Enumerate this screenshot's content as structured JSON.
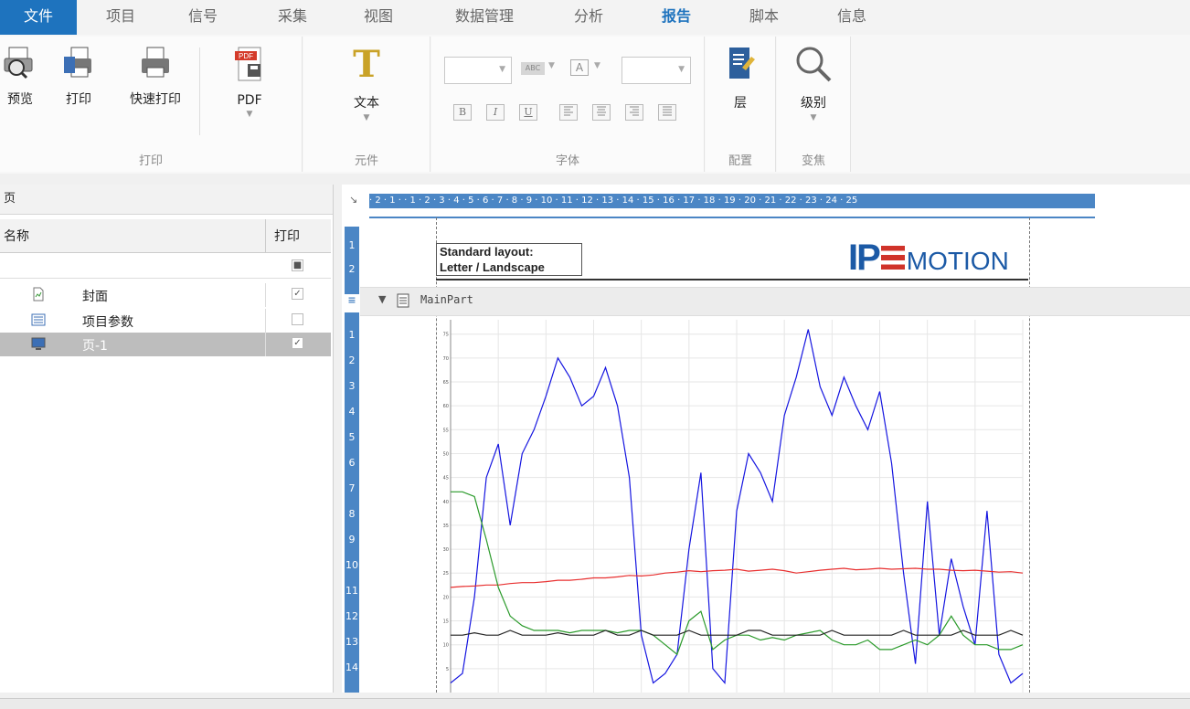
{
  "tabs": [
    "文件",
    "项目",
    "信号",
    "采集",
    "视图",
    "数据管理",
    "分析",
    "报告",
    "脚本",
    "信息"
  ],
  "ribbon": {
    "print_group": {
      "label": "打印",
      "preview": "预览",
      "print": "打印",
      "quick_print": "快速打印",
      "pdf": "PDF"
    },
    "element_group": {
      "label": "元件",
      "text": "文本"
    },
    "font_group": {
      "label": "字体",
      "abc": "ABC",
      "a": "A",
      "bold": "B",
      "italic": "I",
      "underline": "U"
    },
    "config_group": {
      "label": "配置",
      "layer": "层"
    },
    "zoom_group": {
      "label": "变焦",
      "level": "级别"
    }
  },
  "pages_panel": {
    "title": "页",
    "col_name": "名称",
    "col_print": "打印",
    "rows": [
      {
        "name": "封面",
        "checked": true
      },
      {
        "name": "项目参数",
        "checked": false
      },
      {
        "name": "页-1",
        "checked": true
      }
    ]
  },
  "editor": {
    "corner": "↘",
    "ruler_text": "· 2 · 1 ·   · 1 · 2 · 3 · 4 · 5 · 6 · 7 · 8 · 9 · 10 · 11 · 12 · 13 · 14 · 15 · 16 · 17 · 18 · 19 · 20 · 21 · 22 · 23 · 24 · 25",
    "vruler_top": [
      "1",
      "2"
    ],
    "vruler_main": [
      "1",
      "2",
      "3",
      "4",
      "5",
      "6",
      "7",
      "8",
      "9",
      "10",
      "11",
      "12",
      "13",
      "14"
    ],
    "layout_line1": "Standard layout:",
    "layout_line2": "Letter / Landscape",
    "logo_ip": "IP",
    "logo_motion": "MOTION",
    "section_title": "MainPart",
    "colors": {
      "blue": "#1515e0",
      "red": "#e83030",
      "green": "#2a9a2a",
      "black": "#222222"
    }
  },
  "chart_data": {
    "type": "line",
    "y_ticks": [
      "75",
      "70",
      "65",
      "60",
      "55",
      "50",
      "45",
      "40",
      "35",
      "30",
      "25",
      "20",
      "15",
      "10",
      "5"
    ],
    "ylim": [
      0,
      78
    ],
    "series": [
      {
        "values": [
          2,
          4,
          20,
          45,
          52,
          35,
          50,
          55,
          62,
          70,
          66,
          60,
          62,
          68,
          60,
          45,
          12,
          2,
          4,
          8,
          30,
          46,
          5,
          2,
          38,
          50,
          46,
          40,
          58,
          66,
          76,
          64,
          58,
          66,
          60,
          55,
          63,
          48,
          25,
          6,
          40,
          12,
          28,
          18,
          10,
          38,
          8,
          2,
          4
        ]
      },
      {
        "values": [
          22,
          22.2,
          22.3,
          22.5,
          22.5,
          22.8,
          23,
          23,
          23.2,
          23.5,
          23.5,
          23.7,
          24,
          24,
          24.2,
          24.5,
          24.4,
          24.6,
          25,
          25.2,
          25.5,
          25.3,
          25.5,
          25.6,
          25.8,
          25.4,
          25.6,
          25.8,
          25.5,
          25,
          25.3,
          25.6,
          25.8,
          26,
          25.7,
          25.8,
          26,
          25.8,
          25.9,
          26,
          25.8,
          25.8,
          25.6,
          25.5,
          25.6,
          25.4,
          25.2,
          25.3,
          25
        ]
      },
      {
        "values": [
          42,
          42,
          41,
          32,
          22,
          16,
          14,
          13,
          13,
          13,
          12.5,
          13,
          13,
          13,
          12.5,
          13,
          13,
          12,
          10,
          8,
          15,
          17,
          9,
          11,
          12,
          12,
          11,
          11.5,
          11,
          12,
          12.5,
          13,
          11,
          10,
          10,
          11,
          9,
          9,
          10,
          11,
          10,
          12,
          16,
          12,
          10,
          10,
          9,
          9,
          10
        ]
      },
      {
        "values": [
          12,
          12,
          12.5,
          12,
          12,
          13,
          12,
          12,
          12,
          12.5,
          12,
          12,
          12,
          13,
          12,
          12,
          13,
          12,
          12,
          12,
          13,
          12,
          12,
          12,
          12,
          13,
          13,
          12,
          12,
          12,
          12,
          12,
          13,
          12,
          12,
          12,
          12,
          12,
          13,
          12,
          12,
          12,
          12,
          13,
          12,
          12,
          12,
          13,
          12
        ]
      }
    ]
  }
}
